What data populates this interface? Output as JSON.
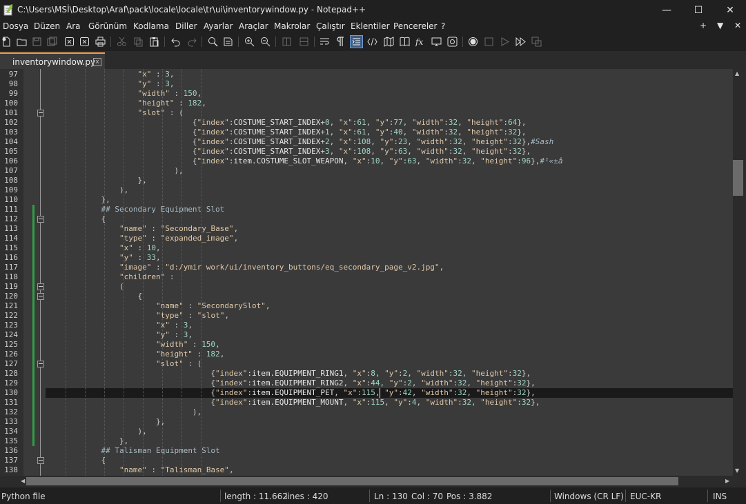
{
  "window": {
    "title": "C:\\Users\\MSİ\\Desktop\\Araf\\pack\\locale\\locale\\tr\\ui\\inventorywindow.py - Notepad++",
    "minimize": "—",
    "maximize": "☐",
    "close": "✕"
  },
  "menu": {
    "items": [
      "Dosya",
      "Düzen",
      "Ara",
      "Görünüm",
      "Kodlama",
      "Diller",
      "Ayarlar",
      "Araçlar",
      "Makrolar",
      "Çalıştır",
      "Eklentiler",
      "Pencereler",
      "?"
    ],
    "right_plus": "+",
    "right_down": "▼",
    "right_close": "✕"
  },
  "tab": {
    "label": "inventorywindow.py",
    "close": "x"
  },
  "editor": {
    "line_numbers": [
      "97",
      "98",
      "99",
      "100",
      "101",
      "102",
      "103",
      "104",
      "105",
      "106",
      "107",
      "108",
      "109",
      "110",
      "111",
      "112",
      "113",
      "114",
      "115",
      "116",
      "117",
      "118",
      "119",
      "120",
      "121",
      "122",
      "123",
      "124",
      "125",
      "126",
      "127",
      "128",
      "129",
      "130",
      "131",
      "132",
      "133",
      "134",
      "135",
      "136",
      "137",
      "138"
    ],
    "current_line": "130",
    "lines": [
      "                    \"x\" : 3,",
      "                    \"y\" : 3,",
      "                    \"width\" : 150,",
      "                    \"height\" : 182,",
      "                    \"slot\" : (",
      "                                {\"index\":COSTUME_START_INDEX+0, \"x\":61, \"y\":77, \"width\":32, \"height\":64},",
      "                                {\"index\":COSTUME_START_INDEX+1, \"x\":61, \"y\":40, \"width\":32, \"height\":32},",
      "                                {\"index\":COSTUME_START_INDEX+2, \"x\":108, \"y\":23, \"width\":32, \"height\":32},#Sash",
      "                                {\"index\":COSTUME_START_INDEX+3, \"x\":108, \"y\":63, \"width\":32, \"height\":32},",
      "                                {\"index\":item.COSTUME_SLOT_WEAPON, \"x\":10, \"y\":63, \"width\":32, \"height\":96},#¹«±â",
      "                            ),",
      "                    },",
      "                ),",
      "            },",
      "            ## Secondary Equipment Slot",
      "            {",
      "                \"name\" : \"Secondary_Base\",",
      "                \"type\" : \"expanded_image\",",
      "                \"x\" : 10,",
      "                \"y\" : 33,",
      "                \"image\" : \"d:/ymir work/ui/inventory_buttons/eq_secondary_page_v2.jpg\",",
      "                \"children\" :",
      "                (",
      "                    {",
      "                        \"name\" : \"SecondarySlot\",",
      "                        \"type\" : \"slot\",",
      "                        \"x\" : 3,",
      "                        \"y\" : 3,",
      "                        \"width\" : 150,",
      "                        \"height\" : 182,",
      "                        \"slot\" : (",
      "                                    {\"index\":item.EQUIPMENT_RING1, \"x\":8, \"y\":2, \"width\":32, \"height\":32},",
      "                                    {\"index\":item.EQUIPMENT_RING2, \"x\":44, \"y\":2, \"width\":32, \"height\":32},",
      "                                    {\"index\":item.EQUIPMENT_PET, \"x\":115, \"y\":42, \"width\":32, \"height\":32},",
      "                                    {\"index\":item.EQUIPMENT_MOUNT, \"x\":115, \"y\":4, \"width\":32, \"height\":32},",
      "                                ),",
      "                        },",
      "                    ),",
      "                },",
      "            ## Talisman Equipment Slot",
      "            {",
      "                \"name\" : \"Talisman_Base\","
    ]
  },
  "status": {
    "language": "Python file",
    "length": "length : 11.662",
    "lines": "lines : 420",
    "ln": "Ln : 130",
    "col": "Col : 70",
    "pos": "Pos : 3.882",
    "eol": "Windows (CR LF)",
    "encoding": "EUC-KR",
    "mode": "INS"
  },
  "icons": [
    "new-file-icon",
    "open-icon",
    "save-icon",
    "save-all-icon",
    "close-icon",
    "close-all-icon",
    "print-icon",
    "cut-icon",
    "copy-icon",
    "paste-icon",
    "undo-icon",
    "redo-icon",
    "find-icon",
    "replace-icon",
    "zoom-in-icon",
    "zoom-out-icon",
    "sync-v-icon",
    "sync-h-icon",
    "wrap-icon",
    "all-chars-icon",
    "indent-guide-icon",
    "lang-icon",
    "doc-map-icon",
    "function-list-icon",
    "fx-icon",
    "monitor-icon",
    "focus-icon",
    "record-macro-icon",
    "stop-macro-icon",
    "play-macro-icon",
    "run-macro-multi-icon",
    "save-macro-icon"
  ]
}
